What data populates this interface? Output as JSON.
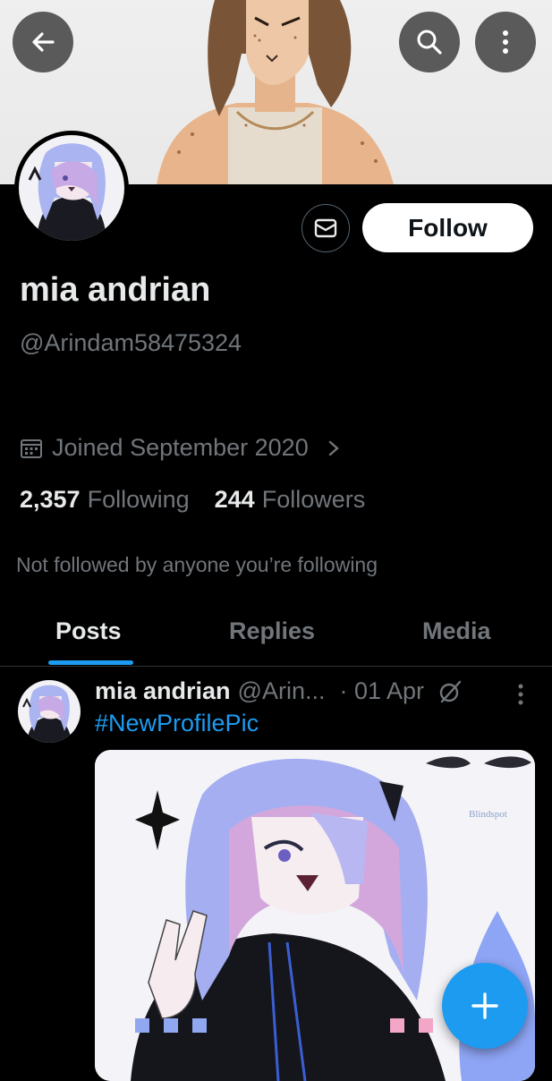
{
  "header": {
    "back_icon": "arrow-left-icon",
    "search_icon": "search-icon",
    "more_icon": "more-vertical-icon"
  },
  "profile": {
    "name": "mia andrian",
    "handle": "@Arindam58475324",
    "joined": "Joined September 2020",
    "following_count": "2,357",
    "following_label": "Following",
    "followers_count": "244",
    "followers_label": "Followers",
    "not_followed_text": "Not followed by anyone you’re following",
    "follow_label": "Follow",
    "message_icon": "envelope-icon"
  },
  "tabs": [
    {
      "label": "Posts",
      "active": true
    },
    {
      "label": "Replies",
      "active": false
    },
    {
      "label": "Media",
      "active": false
    }
  ],
  "post": {
    "author_name": "mia andrian",
    "author_handle_truncated": "@Arin...",
    "date": "· 01 Apr",
    "hashtag": "#NewProfilePic",
    "media_watermark": "Blindspot"
  },
  "colors": {
    "background": "#000000",
    "accent": "#1d9bf0",
    "muted_text": "#71767b",
    "primary_text": "#e7e9ea"
  }
}
